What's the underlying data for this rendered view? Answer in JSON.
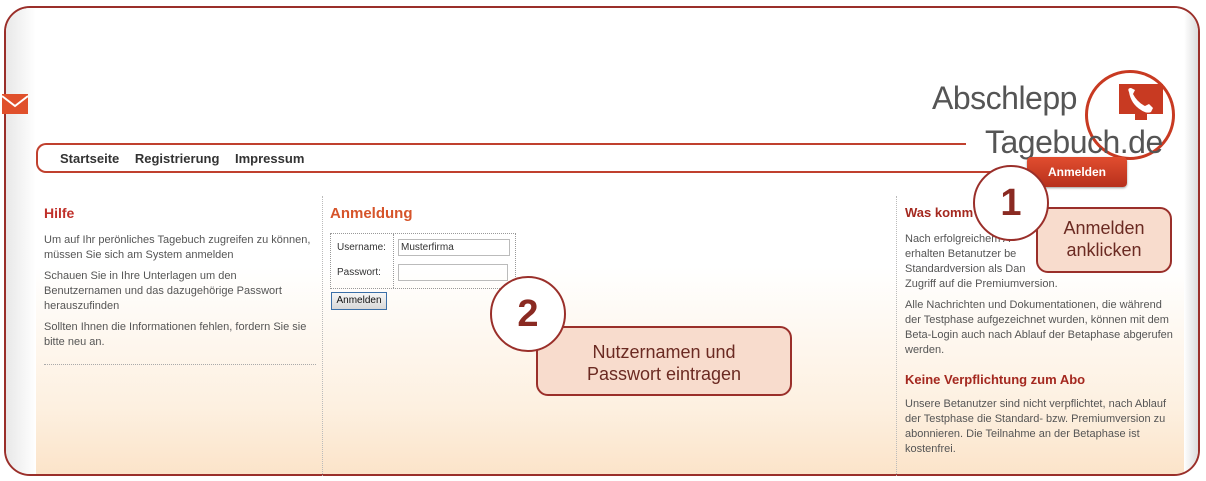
{
  "logo": {
    "line1": "Abschlepp",
    "line2": "Tagebuch.de"
  },
  "nav": {
    "items": [
      "Startseite",
      "Registrierung",
      "Impressum"
    ]
  },
  "top_button": "Anmelden",
  "help": {
    "title": "Hilfe",
    "p1": "Um auf Ihr perönliches Tagebuch zugreifen zu können, müssen Sie sich am System anmelden",
    "p2": "Schauen Sie in Ihre Unterlagen um den Benutzernamen und das dazugehörige Passwort herauszufinden",
    "p3": "Sollten Ihnen die Informationen fehlen, fordern Sie sie bitte neu an."
  },
  "login": {
    "title": "Anmeldung",
    "username_label": "Username:",
    "username_value": "Musterfirma",
    "password_label": "Passwort:",
    "button": "Anmelden"
  },
  "right": {
    "title": "Was komm",
    "p1a": "Nach erfolgreichem A",
    "p1b": "erhalten Betanutzer be",
    "p1c": "Standardversion als Dan",
    "p1d": "Zugriff auf die Premiumversion.",
    "p2": "Alle Nachrichten und Dokumentationen, die während der Testphase aufgezeichnet wurden, können mit dem Beta-Login auch nach Ablauf der Betaphase abgerufen werden.",
    "title2": "Keine Verpflichtung zum Abo",
    "p3": "Unsere Betanutzer sind nicht verpflichtet, nach Ablauf der Testphase die Standard- bzw. Premiumversion zu abonnieren. Die Teilnahme an der Betaphase ist kostenfrei."
  },
  "callouts": {
    "c1_number": "1",
    "c1_text_line1": "Anmelden",
    "c1_text_line2": "anklicken",
    "c2_number": "2",
    "c2_text_line1": "Nutzernamen und",
    "c2_text_line2": "Passwort eintragen"
  },
  "colors": {
    "accent": "#c0302a",
    "frame": "#9a2f2a",
    "callout_fill": "#f8dccd"
  }
}
